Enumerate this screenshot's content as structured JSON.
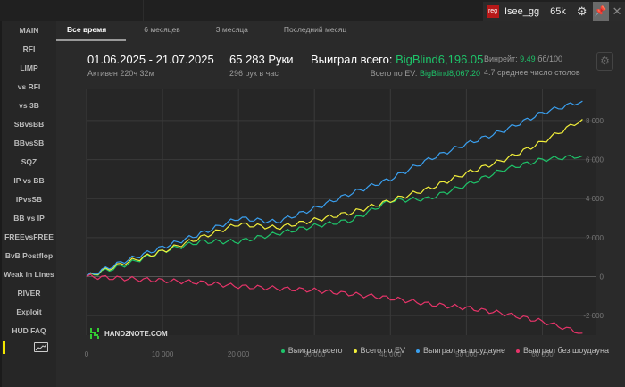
{
  "topbar": {
    "reg": "reg",
    "username": "Isee_gg",
    "hands": "65k"
  },
  "sidebar": {
    "items": [
      "MAIN",
      "RFI",
      "LIMP",
      "vs RFI",
      "vs 3B",
      "SBvsBB",
      "BBvsSB",
      "SQZ",
      "IP vs BB",
      "IPvsSB",
      "BB vs IP",
      "FREEvsFREE",
      "BvB Postflop",
      "Weak in Lines",
      "RIVER",
      "Exploit",
      "HUD FAQ"
    ]
  },
  "tabs": [
    "Все время",
    "6 месяцев",
    "3 месяца",
    "Последний месяц"
  ],
  "stats": {
    "period": "01.06.2025 - 21.07.2025",
    "active": "Активен 220ч 32м",
    "hands": "65 283 Руки",
    "per_hour": "296 рук в час",
    "won_label": "Выиграл всего: ",
    "won_value": "BigBlind6,196.05",
    "ev_label": "Всего по EV: ",
    "ev_value": "BigBlind8,067.20",
    "winrate_label": "Винрейт: ",
    "winrate_value": "9.49",
    "winrate_unit": " бб/100",
    "tables": "4.7 среднее число столов"
  },
  "logo": "HAND2NOTE.COM",
  "chart_data": {
    "type": "line",
    "xlim": [
      0,
      67000
    ],
    "ylim": [
      -3000,
      9600
    ],
    "xticks": [
      0,
      10000,
      20000,
      30000,
      40000,
      50000,
      60000
    ],
    "xtick_labels": [
      "0",
      "10 000",
      "20 000",
      "30 000",
      "40 000",
      "50 000",
      "60 000"
    ],
    "yticks": [
      -2000,
      0,
      2000,
      4000,
      6000,
      8000
    ],
    "ytick_labels": [
      "-2 000",
      "0",
      "2 000",
      "4 000",
      "6 000",
      "8 000"
    ],
    "x": [
      0,
      5000,
      10000,
      15000,
      20000,
      25000,
      30000,
      35000,
      40000,
      45000,
      50000,
      55000,
      60000,
      65283
    ],
    "series": [
      {
        "name": "Выиграл всего",
        "color": "#1ec46a",
        "values": [
          0,
          600,
          1300,
          1800,
          1800,
          2200,
          2600,
          2900,
          3900,
          4000,
          4700,
          5500,
          6000,
          6196
        ]
      },
      {
        "name": "Всего по EV",
        "color": "#f2ef3a",
        "values": [
          0,
          700,
          1300,
          2000,
          2700,
          2500,
          2900,
          3300,
          3900,
          4500,
          5300,
          6000,
          6900,
          8067
        ]
      },
      {
        "name": "Выиграл на шоудауне",
        "color": "#3aa0f0",
        "values": [
          0,
          800,
          1500,
          2200,
          3000,
          2800,
          3500,
          4300,
          5000,
          6000,
          6800,
          7500,
          8400,
          9000
        ]
      },
      {
        "name": "Выиграл без шоудауна",
        "color": "#e8346a",
        "values": [
          0,
          -100,
          -200,
          -300,
          -500,
          -600,
          -700,
          -900,
          -1100,
          -1400,
          -1600,
          -1900,
          -2300,
          -2900
        ]
      }
    ],
    "legend": "bottom-right",
    "grid": true
  }
}
